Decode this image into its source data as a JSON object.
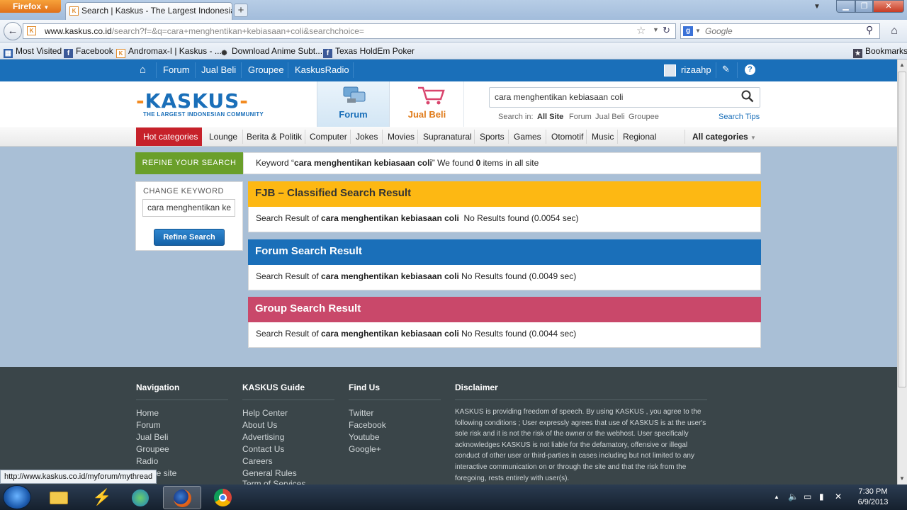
{
  "browser": {
    "app_button": "Firefox",
    "tab_title": "Search | Kaskus - The Largest Indonesian...",
    "url_domain": "www.kaskus.co.id",
    "url_path": "/search?f=&q=cara+menghentikan+kebiasaan+coli&searchchoice=",
    "search_engine": "Google",
    "bookmarks": [
      "Most Visited",
      "Facebook",
      "Andromax-I | Kaskus - ...",
      "Download Anime Subt...",
      "Texas HoldEm Poker"
    ],
    "bookmarks_menu": "Bookmarks"
  },
  "kaskus": {
    "topnav": [
      "Forum",
      "Jual Beli",
      "Groupee",
      "KaskusRadio"
    ],
    "username": "rizaahp",
    "logo_text": "KASKUS",
    "logo_sub": "THE LARGEST INDONESIAN COMMUNITY",
    "tab_forum": "Forum",
    "tab_jualbeli": "Jual Beli",
    "search_value": "cara menghentikan kebiasaan coli",
    "search_in_label": "Search in:",
    "search_in": [
      "All Site",
      "Forum",
      "Jual Beli",
      "Groupee"
    ],
    "search_tips": "Search Tips",
    "hot_categories": "Hot categories",
    "categories": [
      "Lounge",
      "Berita & Politik",
      "Computer",
      "Jokes",
      "Movies",
      "Supranatural",
      "Sports",
      "Games",
      "Otomotif",
      "Music",
      "Regional"
    ],
    "all_categories": "All categories",
    "refine_label": "REFINE YOUR SEARCH",
    "keyword_prefix": "Keyword “",
    "keyword": "cara menghentikan kebiasaan coli",
    "keyword_mid": "” We found ",
    "found_count": "0",
    "keyword_suffix": " items in all site",
    "change_keyword": "CHANGE KEYWORD",
    "keyword_input": "cara menghentikan ke",
    "refine_button": "Refine Search",
    "result_prefix": "Search Result of ",
    "results": [
      {
        "title": "FJB – Classified Search Result",
        "status": "No Results found (0.0054 sec)",
        "color": "#fdb813"
      },
      {
        "title": "Forum Search Result",
        "status": "No Results found (0.0049 sec)",
        "color": "#1a6fb9"
      },
      {
        "title": "Group Search Result",
        "status": "No Results found (0.0044 sec)",
        "color": "#c9486a"
      }
    ]
  },
  "footer": {
    "navigation_title": "Navigation",
    "navigation": [
      "Home",
      "Forum",
      "Jual Beli",
      "Groupee",
      "Radio",
      "Mobile site"
    ],
    "guide_title": "KASKUS Guide",
    "guide": [
      "Help Center",
      "About Us",
      "Advertising",
      "Contact Us",
      "Careers",
      "General Rules",
      "Term of Services"
    ],
    "findus_title": "Find Us",
    "findus": [
      "Twitter",
      "Facebook",
      "Youtube",
      "Google+"
    ],
    "disclaimer_title": "Disclaimer",
    "disclaimer": "KASKUS is providing freedom of speech. By using KASKUS , you agree to the following conditions ; User expressly agrees that use of KASKUS is at the user's sole risk and it is not the risk of the owner or the webhost. User specifically acknowledges KASKUS is not liable for the defamatory, offensive or illegal conduct of other user or third-parties in cases including but not limited to any interactive communication on or through the site and that the risk from the foregoing, rests entirely with user(s)."
  },
  "status_bar": "http://www.kaskus.co.id/myforum/mythread",
  "taskbar": {
    "time": "7:30 PM",
    "date": "6/9/2013"
  }
}
